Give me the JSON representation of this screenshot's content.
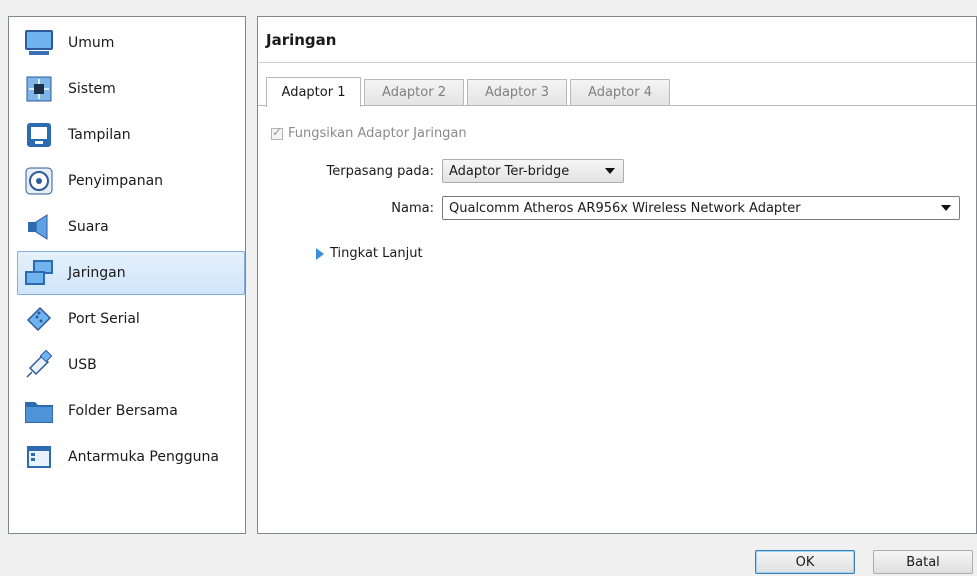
{
  "sidebar": {
    "items": [
      {
        "label": "Umum",
        "icon": "monitor-icon"
      },
      {
        "label": "Sistem",
        "icon": "chip-icon"
      },
      {
        "label": "Tampilan",
        "icon": "display-icon"
      },
      {
        "label": "Penyimpanan",
        "icon": "disk-icon"
      },
      {
        "label": "Suara",
        "icon": "speaker-icon"
      },
      {
        "label": "Jaringan",
        "icon": "network-icon",
        "active": true
      },
      {
        "label": "Port Serial",
        "icon": "serial-port-icon"
      },
      {
        "label": "USB",
        "icon": "usb-icon"
      },
      {
        "label": "Folder Bersama",
        "icon": "folder-icon"
      },
      {
        "label": "Antarmuka Pengguna",
        "icon": "ui-window-icon"
      }
    ]
  },
  "panel": {
    "title": "Jaringan",
    "tabs": [
      "Adaptor 1",
      "Adaptor 2",
      "Adaptor 3",
      "Adaptor 4"
    ],
    "active_tab": "Adaptor 1",
    "enable_label": "Fungsikan Adaptor Jaringan",
    "enable_checked": true,
    "attached_label": "Terpasang pada:",
    "attached_value": "Adaptor Ter-bridge",
    "name_label": "Nama:",
    "name_value": "Qualcomm Atheros AR956x Wireless Network Adapter",
    "advanced_label": "Tingkat Lanjut"
  },
  "buttons": {
    "ok": "OK",
    "cancel": "Batal"
  },
  "colors": {
    "accent": "#3a8fd9",
    "selection": "#cfe5f8",
    "border": "#828790"
  }
}
